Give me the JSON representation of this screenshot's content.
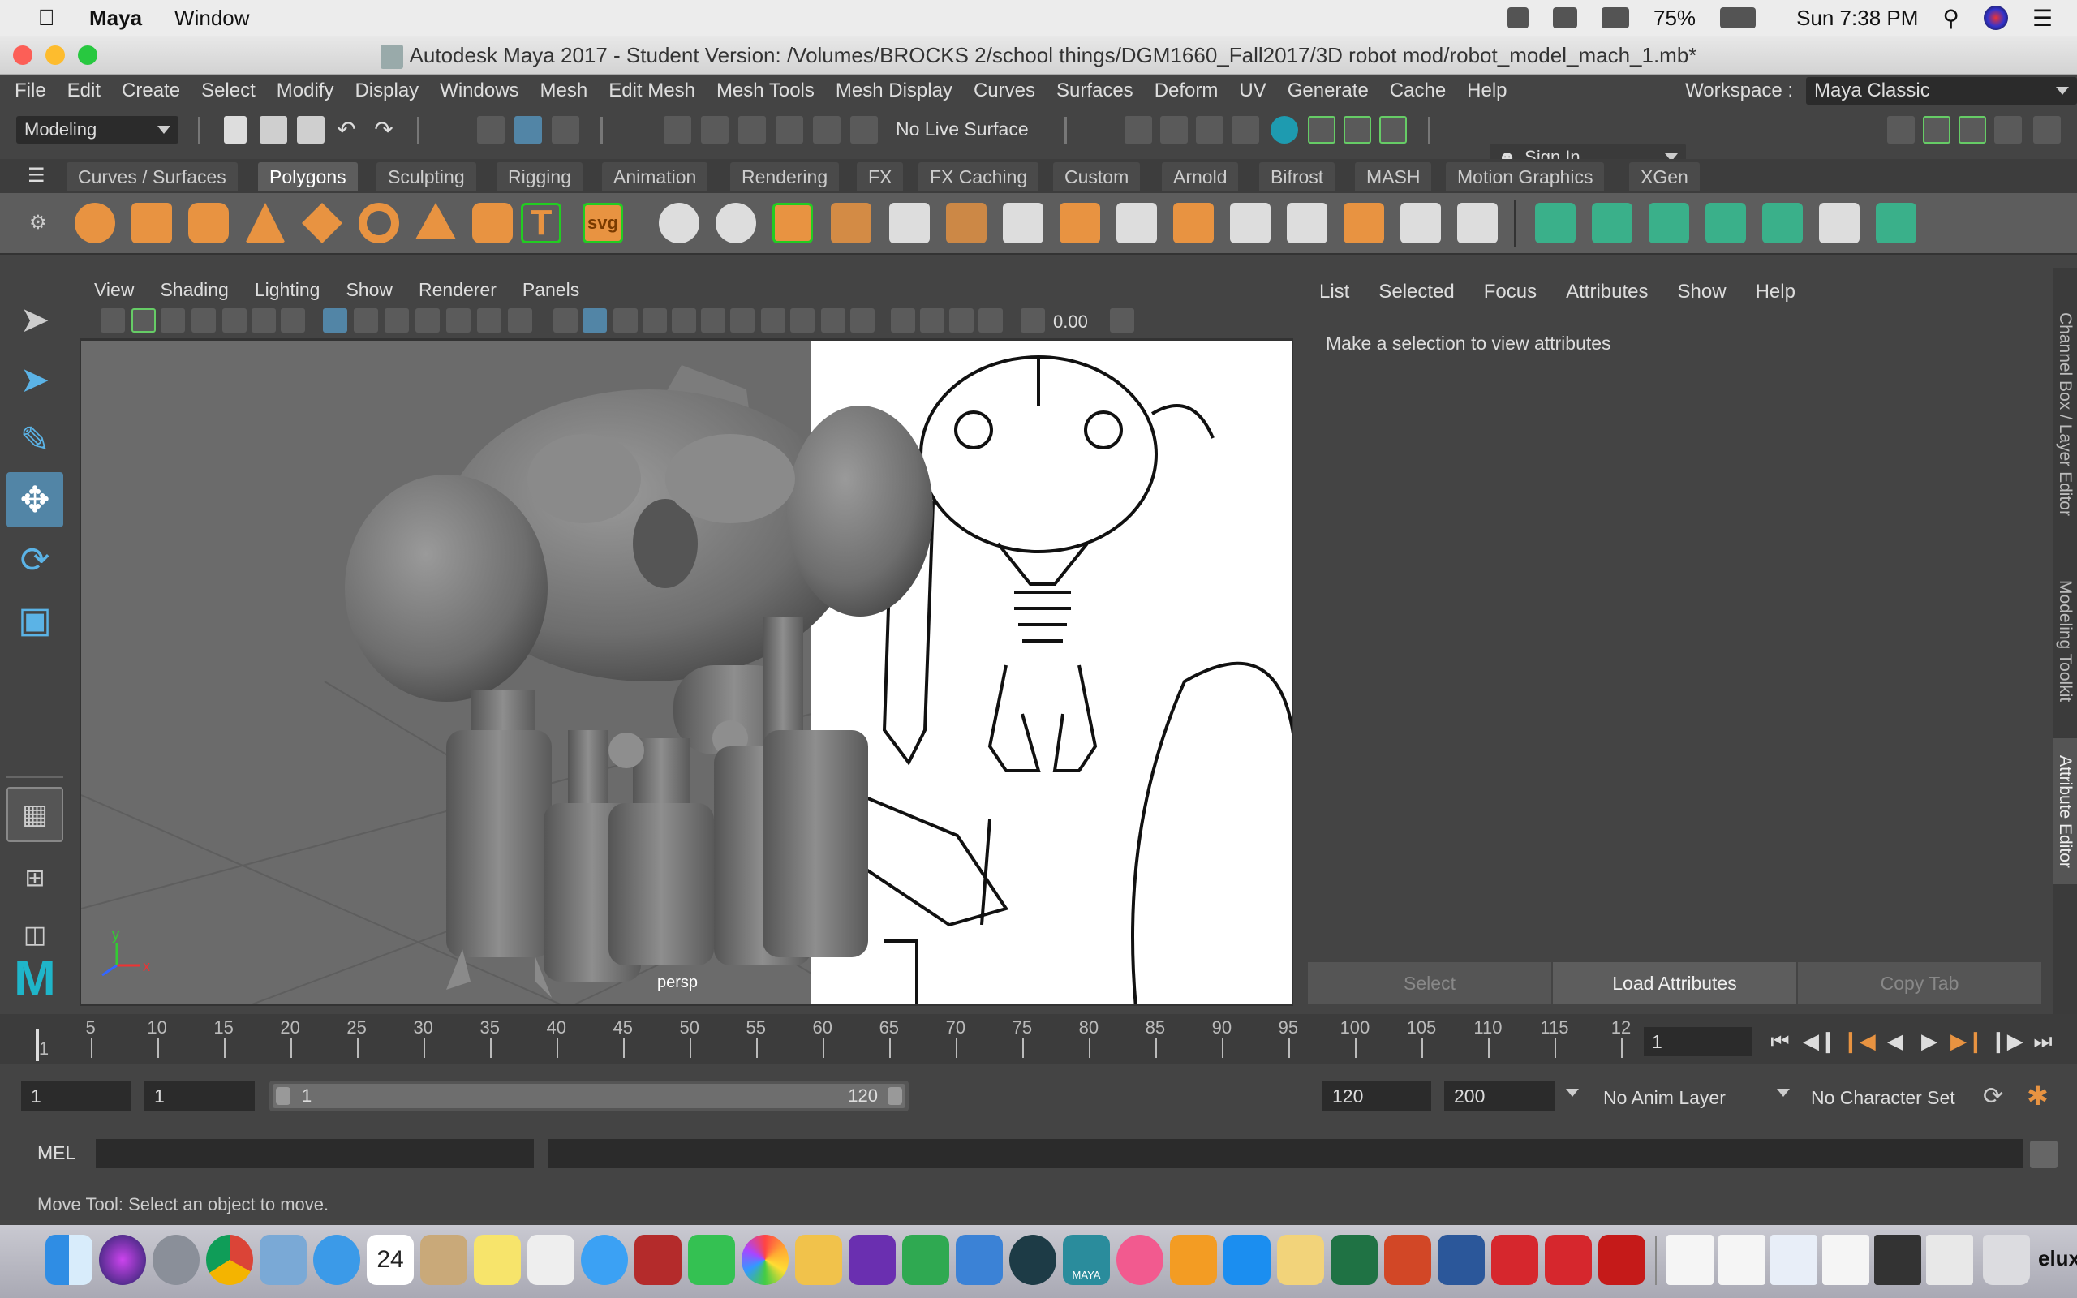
{
  "mac_menubar": {
    "app_name": "Maya",
    "menu_window": "Window",
    "battery": "75%",
    "clock": "Sun 7:38 PM"
  },
  "window": {
    "title": "Autodesk Maya 2017 - Student Version: /Volumes/BROCKS 2/school things/DGM1660_Fall2017/3D robot mod/robot_model_mach_1.mb*"
  },
  "main_menu": {
    "items": [
      "File",
      "Edit",
      "Create",
      "Select",
      "Modify",
      "Display",
      "Windows",
      "Mesh",
      "Edit Mesh",
      "Mesh Tools",
      "Mesh Display",
      "Curves",
      "Surfaces",
      "Deform",
      "UV",
      "Generate",
      "Cache",
      "Help"
    ],
    "workspace_label": "Workspace :",
    "workspace_value": "Maya Classic"
  },
  "status_line": {
    "menu_set": "Modeling",
    "live_surface": "No Live Surface",
    "sign_in": "Sign In"
  },
  "shelf": {
    "tabs": [
      "Curves / Surfaces",
      "Polygons",
      "Sculpting",
      "Rigging",
      "Animation",
      "Rendering",
      "FX",
      "FX Caching",
      "Custom",
      "Arnold",
      "Bifrost",
      "MASH",
      "Motion Graphics",
      "XGen"
    ],
    "active_tab": "Polygons",
    "svg_icon_label": "svg",
    "text_icon_label": "T"
  },
  "viewport": {
    "menu": [
      "View",
      "Shading",
      "Lighting",
      "Show",
      "Renderer",
      "Panels"
    ],
    "exposure_value": "0.00",
    "camera_label": "persp",
    "axis_x": "x",
    "axis_y": "y"
  },
  "attribute_editor": {
    "menu": [
      "List",
      "Selected",
      "Focus",
      "Attributes",
      "Show",
      "Help"
    ],
    "message": "Make a selection to view attributes",
    "buttons": [
      "Select",
      "Load Attributes",
      "Copy Tab"
    ],
    "side_tabs": [
      "Channel Box / Layer Editor",
      "Modeling Toolkit",
      "Attribute Editor"
    ]
  },
  "time_slider": {
    "ticks": [
      "1",
      "5",
      "10",
      "15",
      "20",
      "25",
      "30",
      "35",
      "40",
      "45",
      "50",
      "55",
      "60",
      "65",
      "70",
      "75",
      "80",
      "85",
      "90",
      "95",
      "100",
      "105",
      "110",
      "115",
      "12"
    ],
    "current_frame": "1"
  },
  "range_slider": {
    "start": "1",
    "current": "1",
    "range_start": "1",
    "range_end": "120",
    "playback_end": "120",
    "anim_end": "200",
    "anim_layer": "No Anim Layer",
    "character_set": "No Character Set"
  },
  "command_line": {
    "label": "MEL"
  },
  "help_line": {
    "text": "Move Tool: Select an object to move."
  },
  "dock": {
    "calendar_day": "24",
    "maya_label": "MAYA",
    "partial_text": "elux"
  }
}
